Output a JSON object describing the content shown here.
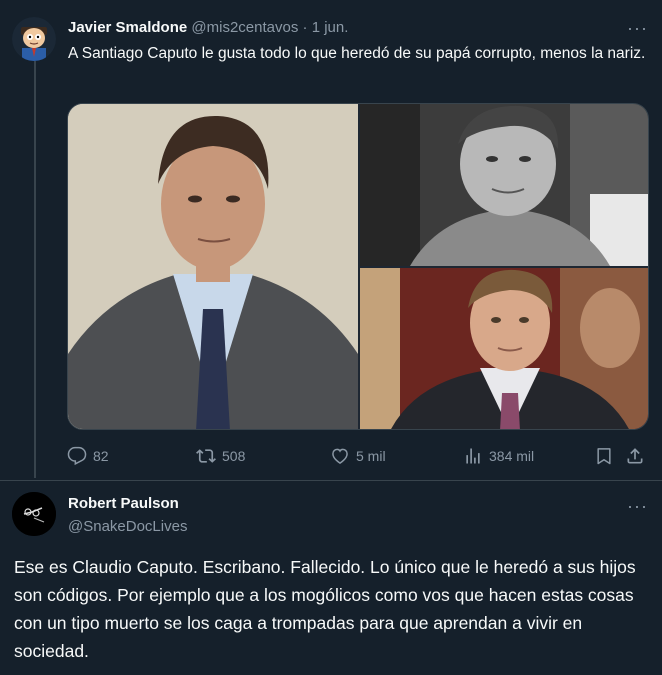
{
  "tweet": {
    "author_name": "Javier Smaldone",
    "handle": "@mis2centavos",
    "separator": "·",
    "date": "1 jun.",
    "text": "A Santiago Caputo le gusta todo lo que heredó de su papá corrupto, menos la nariz.",
    "stats": {
      "replies": "82",
      "retweets": "508",
      "likes": "5 mil",
      "views": "384 mil"
    }
  },
  "reply": {
    "author_name": "Robert Paulson",
    "handle": "@SnakeDocLives",
    "text": "Ese es Claudio Caputo. Escribano. Fallecido. Lo único que le heredó a sus hijos son códigos. Por ejemplo que a los mogólicos como vos que hacen estas cosas con un tipo muerto se los caga a trompadas para que aprendan a vivir en sociedad."
  },
  "icons": {
    "more": "more-dots-icon",
    "reply": "reply-icon",
    "retweet": "retweet-icon",
    "like": "heart-icon",
    "views": "views-icon",
    "bookmark": "bookmark-icon",
    "share": "share-icon"
  },
  "colors": {
    "background": "#15202b",
    "text": "#f7f9f9",
    "muted": "#8b98a5",
    "border": "#38444d"
  }
}
